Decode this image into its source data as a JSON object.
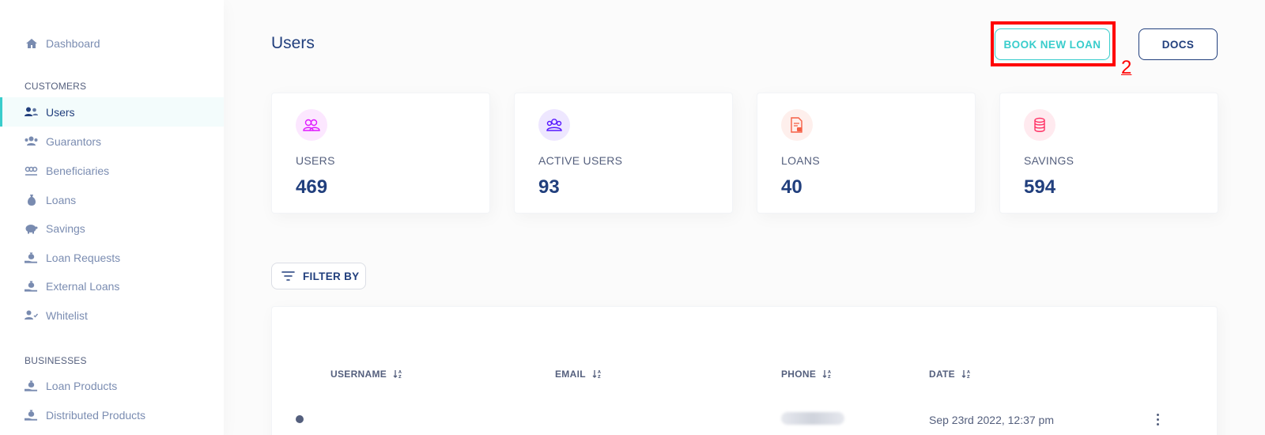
{
  "sidebar": {
    "dashboard": "Dashboard",
    "sections": {
      "customers": "CUSTOMERS",
      "businesses": "BUSINESSES"
    },
    "customers_items": [
      {
        "label": "Users",
        "icon": "users-icon"
      },
      {
        "label": "Guarantors",
        "icon": "guarantors-icon"
      },
      {
        "label": "Beneficiaries",
        "icon": "beneficiaries-icon"
      },
      {
        "label": "Loans",
        "icon": "loan-sack-icon"
      },
      {
        "label": "Savings",
        "icon": "piggy-bank-icon"
      },
      {
        "label": "Loan Requests",
        "icon": "hand-money-icon"
      },
      {
        "label": "External Loans",
        "icon": "hand-money-icon"
      },
      {
        "label": "Whitelist",
        "icon": "user-check-icon"
      }
    ],
    "businesses_items": [
      {
        "label": "Loan Products",
        "icon": "hand-money-icon"
      },
      {
        "label": "Distributed Products",
        "icon": "hand-money-icon"
      }
    ],
    "active_item": "Users"
  },
  "header": {
    "title": "Users",
    "book_loan_label": "BOOK NEW LOAN",
    "docs_label": "DOCS",
    "annotation_marker": "2"
  },
  "stats": [
    {
      "label": "USERS",
      "value": "469",
      "icon": "users-icon",
      "color": "#df18ff"
    },
    {
      "label": "ACTIVE USERS",
      "value": "93",
      "icon": "active-users-icon",
      "color": "#5718ff"
    },
    {
      "label": "LOANS",
      "value": "40",
      "icon": "loan-document-icon",
      "color": "#f55f44"
    },
    {
      "label": "SAVINGS",
      "value": "594",
      "icon": "coins-icon",
      "color": "#ff3366"
    }
  ],
  "filter": {
    "label": "FILTER BY"
  },
  "table": {
    "columns": [
      "USERNAME",
      "EMAIL",
      "PHONE",
      "DATE"
    ],
    "rows": [
      {
        "username": "",
        "email": "",
        "phone": "",
        "date": "Sep 23rd 2022, 12:37 pm"
      }
    ]
  },
  "colors": {
    "accent": "#39cdcc",
    "primary": "#213f7d",
    "highlight": "#ff0000"
  }
}
